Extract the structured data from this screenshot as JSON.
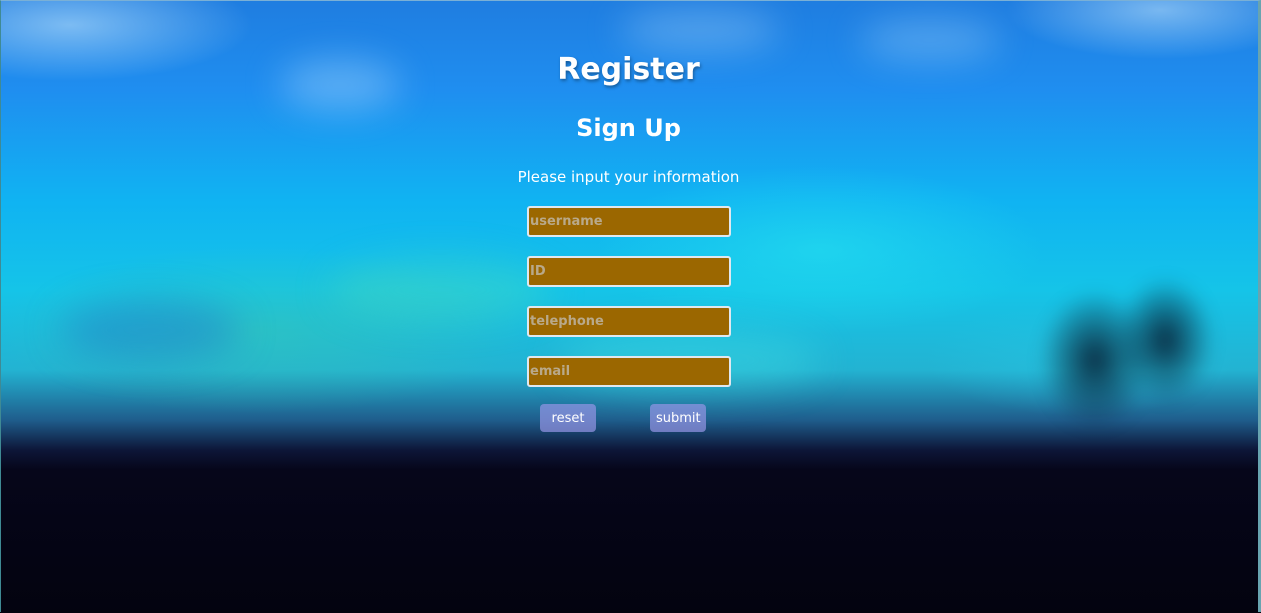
{
  "title": "Register",
  "subtitle": "Sign Up",
  "prompt": "Please input your information",
  "fields": [
    {
      "name": "username",
      "placeholder": "username",
      "value": ""
    },
    {
      "name": "id",
      "placeholder": "ID",
      "value": ""
    },
    {
      "name": "telephone",
      "placeholder": "telephone",
      "value": ""
    },
    {
      "name": "email",
      "placeholder": "email",
      "value": ""
    }
  ],
  "buttons": {
    "reset_label": "reset",
    "submit_label": "submit"
  },
  "colors": {
    "field_background": "#9b6700",
    "button_background": "#9696e6",
    "text": "#ffffff"
  }
}
